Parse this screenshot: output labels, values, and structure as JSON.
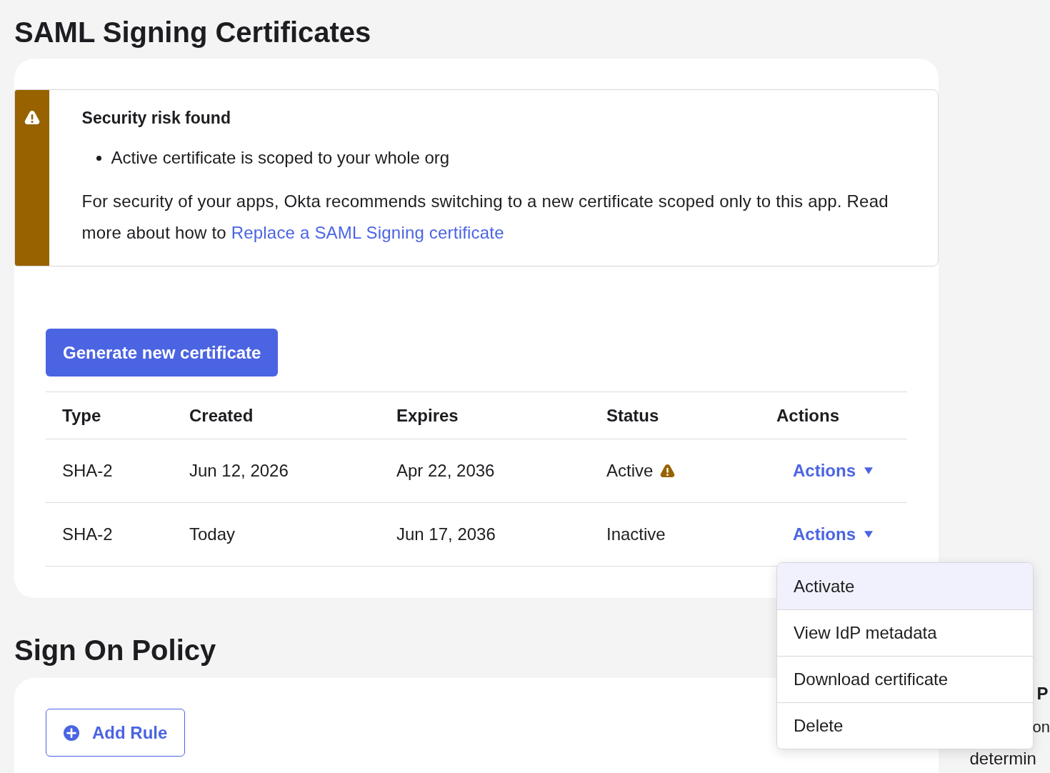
{
  "title": "SAML Signing Certificates",
  "alert": {
    "title": "Security risk found",
    "bullets": [
      "Active certificate is scoped to your whole org"
    ],
    "body": "For security of your apps, Okta recommends switching to a new certificate scoped only to this app. Read more about how to ",
    "link": "Replace a SAML Signing certificate"
  },
  "generate_button": "Generate new certificate",
  "table": {
    "columns": [
      "Type",
      "Created",
      "Expires",
      "Status",
      "Actions"
    ],
    "rows": [
      {
        "type": "SHA-2",
        "created": "Jun 12, 2026",
        "expires": "Apr 22, 2036",
        "status": "Active",
        "warning": true,
        "action": "Actions"
      },
      {
        "type": "SHA-2",
        "created": "Today",
        "expires": "Jun 17, 2036",
        "status": "Inactive",
        "warning": false,
        "action": "Actions"
      }
    ]
  },
  "menu": [
    {
      "label": "Activate",
      "selected": true
    },
    {
      "label": "View IdP metadata",
      "selected": false
    },
    {
      "label": "Download certificate",
      "selected": false
    },
    {
      "label": "Delete",
      "selected": false
    }
  ],
  "policy": {
    "title": "Sign On Policy",
    "add_rule": "Add Rule"
  },
  "side_texts": [
    "P",
    "on",
    "determin"
  ]
}
